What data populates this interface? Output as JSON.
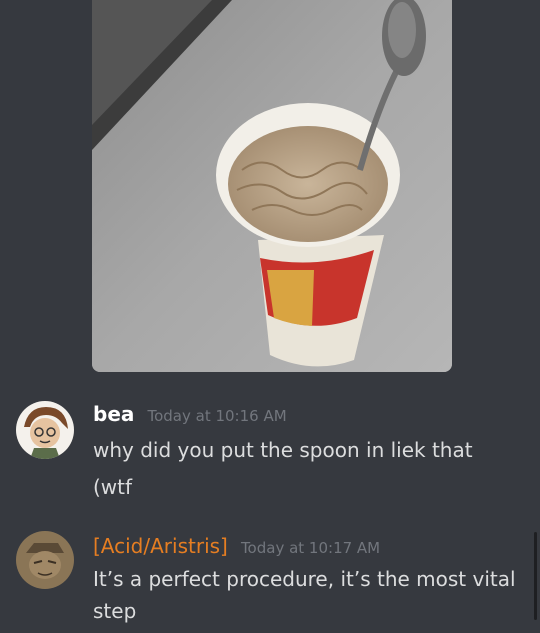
{
  "attachment": {
    "icon": "image-attachment"
  },
  "messages": [
    {
      "author": "bea",
      "timestamp": "Today at 10:16 AM",
      "lines": [
        "why did you put the spoon in liek that",
        "(wtf"
      ],
      "author_color": "#ffffff"
    },
    {
      "author": "[Acid/Aristris]",
      "timestamp": "Today at 10:17 AM",
      "lines": [
        "It’s a perfect procedure, it’s the most vital",
        "step"
      ],
      "author_color": "#e67e22"
    }
  ]
}
